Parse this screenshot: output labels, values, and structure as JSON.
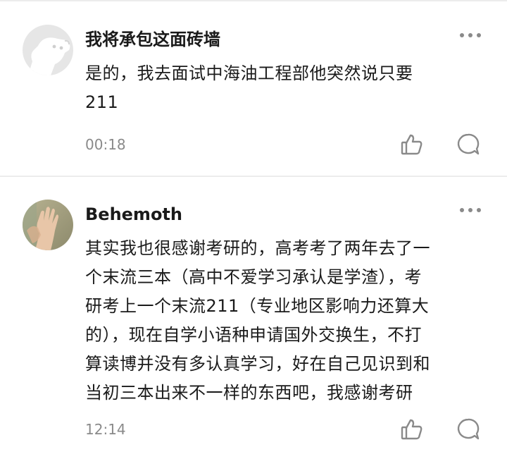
{
  "comments": [
    {
      "username": "我将承包这面砖墙",
      "lines": [
        "是的，我去面试中海油工程部他突然说只要",
        "211"
      ],
      "time": "00:18",
      "avatar_icon": "dog-avatar-icon"
    },
    {
      "username": "Behemoth",
      "lines": [
        "其实我也很感谢考研的，高考考了两年去了一",
        "个末流三本（高中不爱学习承认是学渣），考",
        "研考上一个末流211（专业地区影响力还算大",
        "的），现在自学小语种申请国外交换生，不打",
        "算读博并没有多认真学习，好在自己见识到和",
        "当初三本出来不一样的东西吧，我感谢考研"
      ],
      "time": "12:14",
      "avatar_icon": "hand-photo-avatar-icon"
    }
  ],
  "colors": {
    "text_primary": "#1a1a1a",
    "text_secondary": "#8a8a8a",
    "divider": "#ececec",
    "icon": "#8a8a8a"
  }
}
